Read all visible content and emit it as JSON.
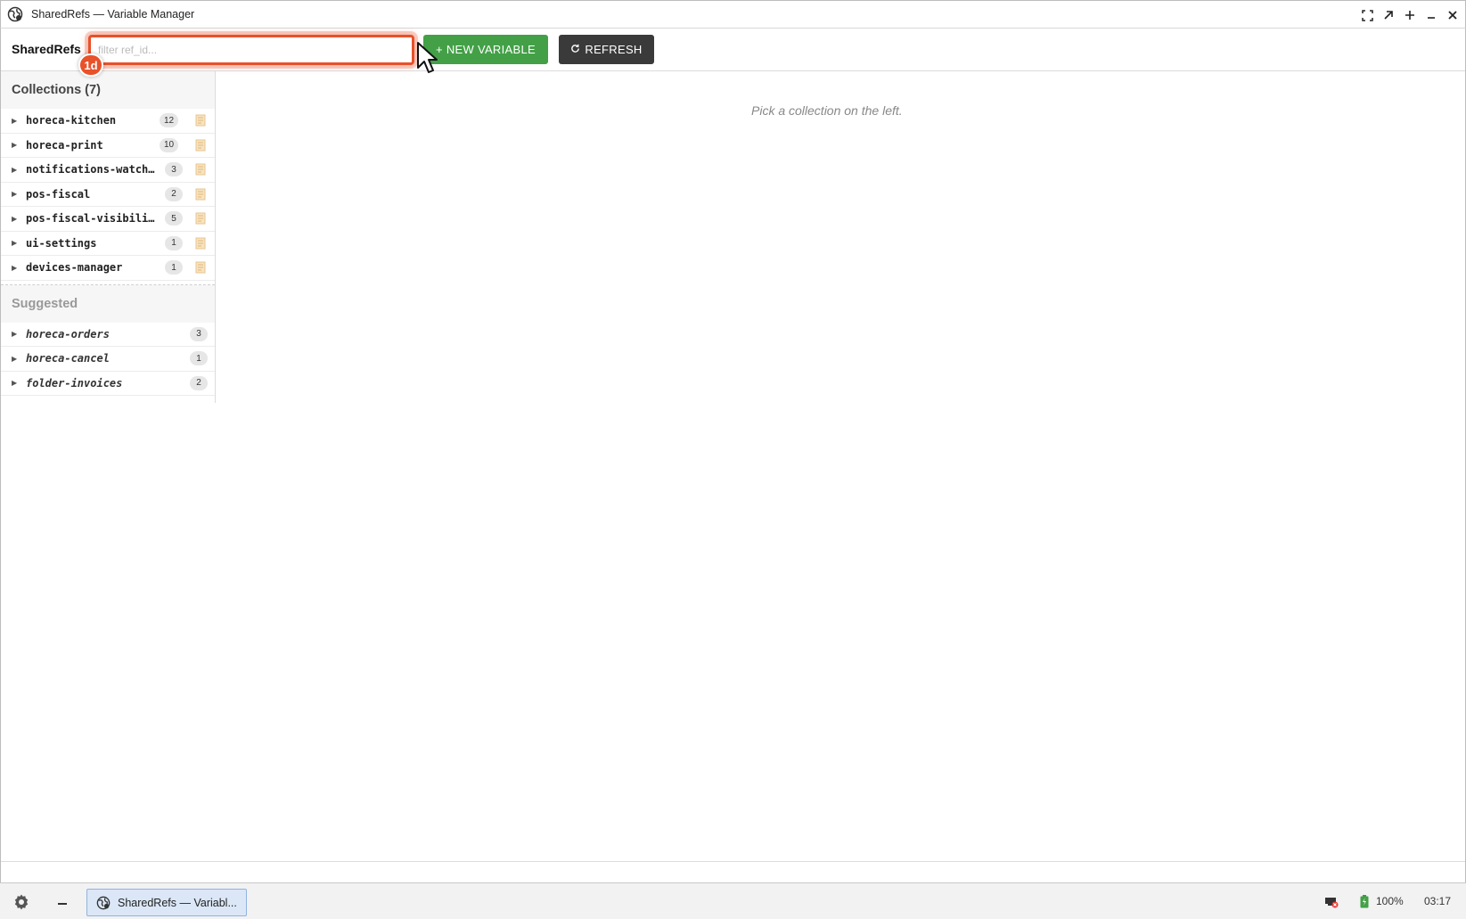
{
  "window": {
    "title": "SharedRefs — Variable Manager"
  },
  "toolbar": {
    "brand": "SharedRefs",
    "filter_placeholder": "filter ref_id...",
    "annotation_badge": "1d",
    "new_variable_label": "+ NEW VARIABLE",
    "refresh_label": "REFRESH"
  },
  "sidebar": {
    "collections_title": "Collections (7)",
    "collections": [
      {
        "name": "horeca-kitchen",
        "count": "12"
      },
      {
        "name": "horeca-print",
        "count": "10"
      },
      {
        "name": "notifications-watchers",
        "count": "3"
      },
      {
        "name": "pos-fiscal",
        "count": "2"
      },
      {
        "name": "pos-fiscal-visibility",
        "count": "5"
      },
      {
        "name": "ui-settings",
        "count": "1"
      },
      {
        "name": "devices-manager",
        "count": "1"
      }
    ],
    "suggested_title": "Suggested",
    "suggested": [
      {
        "name": "horeca-orders",
        "count": "3"
      },
      {
        "name": "horeca-cancel",
        "count": "1"
      },
      {
        "name": "folder-invoices",
        "count": "2"
      }
    ]
  },
  "main": {
    "empty_message": "Pick a collection on the left."
  },
  "taskbar": {
    "task_label": "SharedRefs — Variabl...",
    "battery": "100%",
    "time": "03:17"
  },
  "colors": {
    "accent_new": "#43a047",
    "refresh_bg": "#3a3a3a",
    "highlight": "#e8512a"
  }
}
